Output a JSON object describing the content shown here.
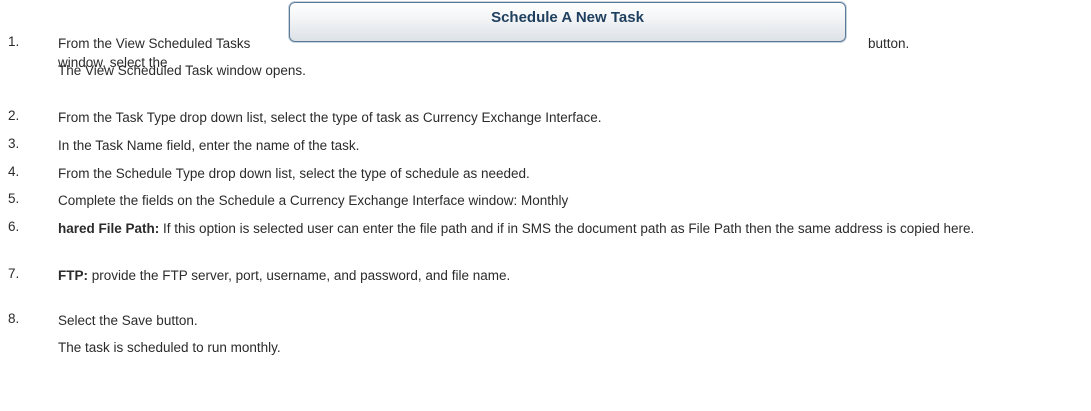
{
  "steps": [
    {
      "num": "1.",
      "before": "From the View Scheduled Tasks window, select the",
      "button_label": "Schedule A New Task",
      "after": "button.",
      "sub": "The View Scheduled Task window opens."
    },
    {
      "num": "2.",
      "text": "From the Task Type drop down list, select the type of task as Currency Exchange Interface."
    },
    {
      "num": "3.",
      "text": "In the Task Name field, enter the name of the task."
    },
    {
      "num": "4.",
      "text": "From the Schedule Type drop down list, select the type of schedule as needed."
    },
    {
      "num": "5.",
      "text": "Complete the fields on the Schedule a Currency Exchange Interface window: Monthly"
    },
    {
      "num": "6.",
      "bold": "hared File Path:",
      "text": "If this option is selected user can enter the file path and if in SMS the document path as File Path then the same address is copied here."
    },
    {
      "num": "7.",
      "bold": "FTP:",
      "text": " provide the FTP server, port, username, and password, and file name."
    },
    {
      "num": "8.",
      "text": "Select the Save button.",
      "sub": "The task is scheduled to run monthly."
    }
  ]
}
